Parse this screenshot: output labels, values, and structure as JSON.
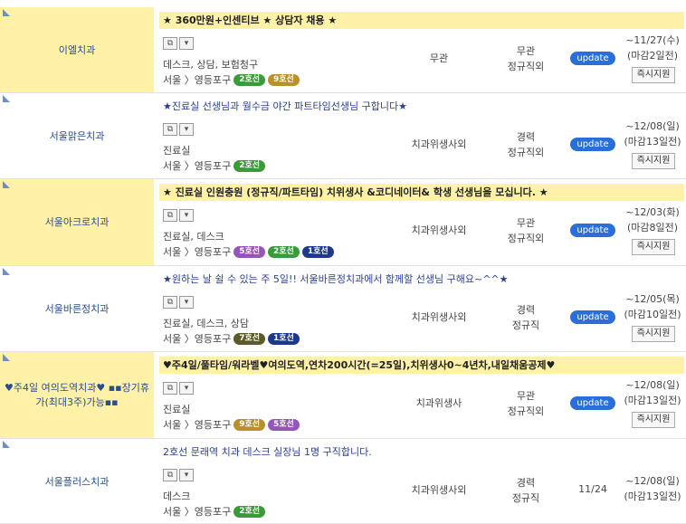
{
  "colors": {
    "highlight": "#fff2a8",
    "update_badge": "#2a6fd9",
    "company_text": "#2a4d8f"
  },
  "listings": [
    {
      "company": "이엘치과",
      "title": "★ 360만원+인센티브 ★ 상담자 채용 ★",
      "highlighted": true,
      "job": "데스크, 상담, 보험청구",
      "location": "서울 〉영등포구",
      "lines": [
        {
          "label": "2호선",
          "color": "#3a9b3a"
        },
        {
          "label": "9호선",
          "color": "#b8902e"
        }
      ],
      "qualification": "무관",
      "experience": "무관",
      "employment": "정규직외",
      "status": "update",
      "deadline": "~11/27(수)",
      "remaining": "(마감2일전)",
      "apply": "즉시지원"
    },
    {
      "company": "서울맑은치과",
      "title": "★진료실 선생님과 월수금 야간 파트타임선생님 구합니다★",
      "highlighted": false,
      "job": "진료실",
      "location": "서울 〉영등포구",
      "lines": [
        {
          "label": "2호선",
          "color": "#3a9b3a"
        }
      ],
      "qualification": "치과위생사외",
      "experience": "경력",
      "employment": "정규직외",
      "status": "update",
      "deadline": "~12/08(일)",
      "remaining": "(마감13일전)",
      "apply": "즉시지원"
    },
    {
      "company": "서울아크로치과",
      "title": "★ 진료실 인원충원 (정규직/파트타임) 치위생사 &코디네이터& 학생 선생님을 모십니다. ★",
      "highlighted": true,
      "job": "진료실, 데스크",
      "location": "서울 〉영등포구",
      "lines": [
        {
          "label": "5호선",
          "color": "#9457b8"
        },
        {
          "label": "2호선",
          "color": "#3a9b3a"
        },
        {
          "label": "1호선",
          "color": "#1d3a8a"
        }
      ],
      "qualification": "치과위생사외",
      "experience": "무관",
      "employment": "정규직외",
      "status": "update",
      "deadline": "~12/03(화)",
      "remaining": "(마감8일전)",
      "apply": "즉시지원"
    },
    {
      "company": "서울바른정치과",
      "title": "★원하는 날 쉴 수 있는 주 5일!! 서울바른정치과에서 함께할 선생님 구해요~^^★",
      "highlighted": false,
      "job": "진료실, 데스크, 상담",
      "location": "서울 〉영등포구",
      "lines": [
        {
          "label": "7호선",
          "color": "#5b5a2a"
        },
        {
          "label": "1호선",
          "color": "#1d3a8a"
        }
      ],
      "qualification": "치과위생사외",
      "experience": "경력",
      "employment": "정규직",
      "status": "update",
      "deadline": "~12/05(목)",
      "remaining": "(마감10일전)",
      "apply": "즉시지원"
    },
    {
      "company": "♥주4일 여의도역치과♥ ▪▪장기휴가(최대3주)가능▪▪",
      "title": "♥주4일/풀타임/워라벨♥여의도역,연차200시간(=25일),치위생사0~4년차,내일채움공제♥",
      "highlighted": true,
      "job": "진료실",
      "location": "서울 〉영등포구",
      "lines": [
        {
          "label": "9호선",
          "color": "#b8902e"
        },
        {
          "label": "5호선",
          "color": "#9457b8"
        }
      ],
      "qualification": "치과위생사",
      "experience": "무관",
      "employment": "정규직외",
      "status": "update",
      "deadline": "~12/08(일)",
      "remaining": "(마감13일전)",
      "apply": "즉시지원"
    },
    {
      "company": "서울플러스치과",
      "title": "2호선 문래역 치과 데스크 실장님 1명 구직합니다.",
      "highlighted": false,
      "job": "데스크",
      "location": "서울 〉영등포구",
      "lines": [
        {
          "label": "2호선",
          "color": "#3a9b3a"
        }
      ],
      "qualification": "치과위생사외",
      "experience": "경력",
      "employment": "정규직",
      "status": "11/24",
      "deadline": "~12/08(일)",
      "remaining": "(마감13일전)",
      "apply": ""
    }
  ]
}
